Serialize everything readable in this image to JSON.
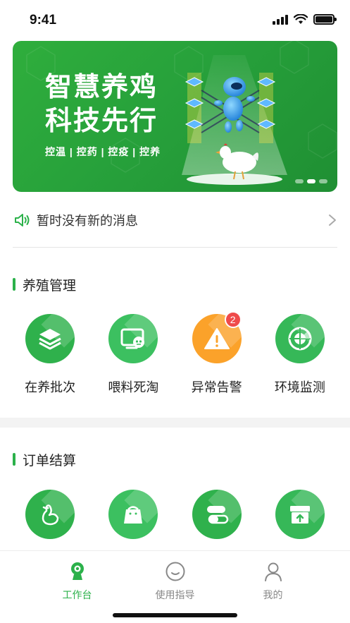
{
  "status_bar": {
    "time": "9:41"
  },
  "banner": {
    "title_line1": "智慧养鸡",
    "title_line2": "科技先行",
    "subtitle": "控温 | 控药 | 控疫 | 控养",
    "page_count": 3,
    "active_page": 1
  },
  "notice": {
    "text": "暂时没有新的消息"
  },
  "sections": {
    "breeding": {
      "title": "养殖管理",
      "items": [
        {
          "label": "在养批次",
          "icon": "layers-icon"
        },
        {
          "label": "喂料死淘",
          "icon": "feed-monitor-icon"
        },
        {
          "label": "异常告警",
          "icon": "warning-icon",
          "badge": "2"
        },
        {
          "label": "环境监测",
          "icon": "radar-icon"
        }
      ]
    },
    "orders": {
      "title": "订单结算",
      "items": [
        {
          "icon": "chicken-icon"
        },
        {
          "icon": "feed-bag-icon"
        },
        {
          "icon": "pill-icon"
        },
        {
          "icon": "box-upload-icon"
        }
      ]
    }
  },
  "tab_bar": {
    "tabs": [
      {
        "label": "工作台",
        "icon": "camera-icon",
        "active": true
      },
      {
        "label": "使用指导",
        "icon": "smile-icon",
        "active": false
      },
      {
        "label": "我的",
        "icon": "user-icon",
        "active": false
      }
    ]
  },
  "colors": {
    "accent": "#2bb14a",
    "warning": "#fba22a",
    "badge": "#ef4b4b"
  }
}
